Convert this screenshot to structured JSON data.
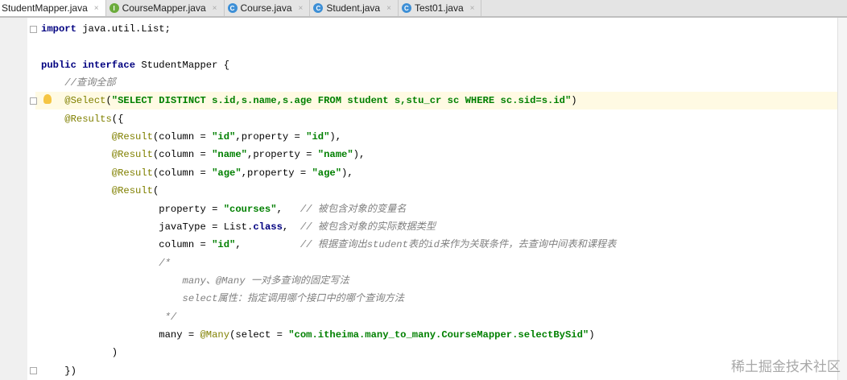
{
  "tabs": [
    {
      "label": "StudentMapper.java",
      "icon": "",
      "active": true
    },
    {
      "label": "CourseMapper.java",
      "icon": "I",
      "active": false
    },
    {
      "label": "Course.java",
      "icon": "C",
      "active": false
    },
    {
      "label": "Student.java",
      "icon": "C",
      "active": false
    },
    {
      "label": "Test01.java",
      "icon": "C",
      "active": false
    }
  ],
  "tab_close": "×",
  "lines": [
    {
      "i": 0,
      "tokens": [
        {
          "t": "import",
          "c": "kw"
        },
        {
          "t": " java.util.List;",
          "c": ""
        }
      ]
    },
    {
      "i": 0,
      "tokens": []
    },
    {
      "i": 0,
      "tokens": [
        {
          "t": "public interface",
          "c": "kw"
        },
        {
          "t": " StudentMapper {",
          "c": ""
        }
      ]
    },
    {
      "i": 4,
      "tokens": [
        {
          "t": "//查询全部",
          "c": "cmt"
        }
      ]
    },
    {
      "i": 4,
      "hl": true,
      "tokens": [
        {
          "t": "@Select",
          "c": "ann"
        },
        {
          "t": "(",
          "c": ""
        },
        {
          "t": "\"SELECT DISTINCT s.id,s.name,s.age FROM student s,stu_cr sc WHERE sc.sid=s.id\"",
          "c": "str"
        },
        {
          "t": ")",
          "c": ""
        }
      ]
    },
    {
      "i": 4,
      "tokens": [
        {
          "t": "@Results",
          "c": "ann"
        },
        {
          "t": "({",
          "c": ""
        }
      ]
    },
    {
      "i": 12,
      "tokens": [
        {
          "t": "@Result",
          "c": "ann"
        },
        {
          "t": "(column = ",
          "c": ""
        },
        {
          "t": "\"id\"",
          "c": "str"
        },
        {
          "t": ",property = ",
          "c": ""
        },
        {
          "t": "\"id\"",
          "c": "str"
        },
        {
          "t": "),",
          "c": ""
        }
      ]
    },
    {
      "i": 12,
      "tokens": [
        {
          "t": "@Result",
          "c": "ann"
        },
        {
          "t": "(column = ",
          "c": ""
        },
        {
          "t": "\"name\"",
          "c": "str"
        },
        {
          "t": ",property = ",
          "c": ""
        },
        {
          "t": "\"name\"",
          "c": "str"
        },
        {
          "t": "),",
          "c": ""
        }
      ]
    },
    {
      "i": 12,
      "tokens": [
        {
          "t": "@Result",
          "c": "ann"
        },
        {
          "t": "(column = ",
          "c": ""
        },
        {
          "t": "\"age\"",
          "c": "str"
        },
        {
          "t": ",property = ",
          "c": ""
        },
        {
          "t": "\"age\"",
          "c": "str"
        },
        {
          "t": "),",
          "c": ""
        }
      ]
    },
    {
      "i": 12,
      "tokens": [
        {
          "t": "@Result",
          "c": "ann"
        },
        {
          "t": "(",
          "c": ""
        }
      ]
    },
    {
      "i": 20,
      "tokens": [
        {
          "t": "property = ",
          "c": ""
        },
        {
          "t": "\"courses\"",
          "c": "str"
        },
        {
          "t": ",   ",
          "c": ""
        },
        {
          "t": "// 被包含对象的变量名",
          "c": "cmt"
        }
      ]
    },
    {
      "i": 20,
      "tokens": [
        {
          "t": "javaType = List.",
          "c": ""
        },
        {
          "t": "class",
          "c": "kw"
        },
        {
          "t": ",  ",
          "c": ""
        },
        {
          "t": "// 被包含对象的实际数据类型",
          "c": "cmt"
        }
      ]
    },
    {
      "i": 20,
      "tokens": [
        {
          "t": "column = ",
          "c": ""
        },
        {
          "t": "\"id\"",
          "c": "str"
        },
        {
          "t": ",          ",
          "c": ""
        },
        {
          "t": "// 根据查询出student表的id来作为关联条件，去查询中间表和课程表",
          "c": "cmt"
        }
      ]
    },
    {
      "i": 20,
      "tokens": [
        {
          "t": "/*",
          "c": "cmt"
        }
      ]
    },
    {
      "i": 24,
      "tokens": [
        {
          "t": "many、@Many 一对多查询的固定写法",
          "c": "cmt"
        }
      ]
    },
    {
      "i": 24,
      "tokens": [
        {
          "t": "select属性：指定调用哪个接口中的哪个查询方法",
          "c": "cmt"
        }
      ]
    },
    {
      "i": 21,
      "tokens": [
        {
          "t": "*/",
          "c": "cmt"
        }
      ]
    },
    {
      "i": 20,
      "tokens": [
        {
          "t": "many = ",
          "c": ""
        },
        {
          "t": "@Many",
          "c": "ann"
        },
        {
          "t": "(select = ",
          "c": ""
        },
        {
          "t": "\"com.itheima.many_to_many.CourseMapper.selectBySid\"",
          "c": "str"
        },
        {
          "t": ")",
          "c": ""
        }
      ]
    },
    {
      "i": 12,
      "tokens": [
        {
          "t": ")",
          "c": ""
        }
      ]
    },
    {
      "i": 4,
      "tokens": [
        {
          "t": "})",
          "c": ""
        }
      ]
    }
  ],
  "watermark": "稀土掘金技术社区"
}
